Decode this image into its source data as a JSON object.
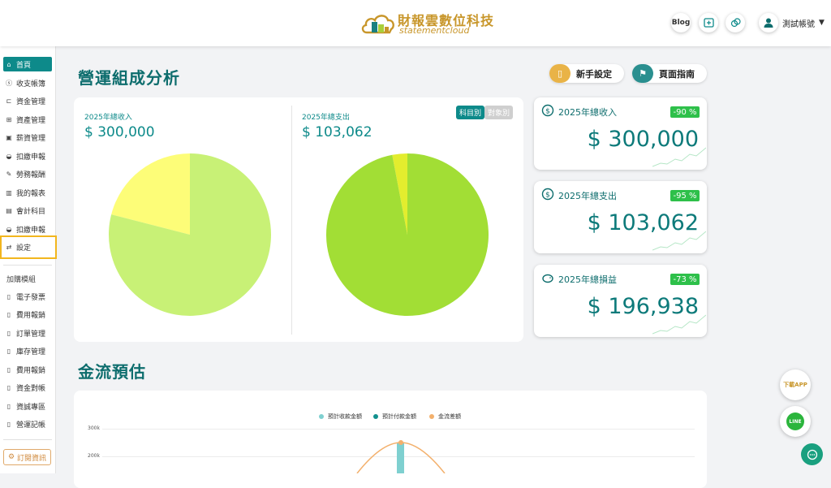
{
  "header": {
    "logo_title": "財報雲數位科技",
    "logo_subtitle": "statementcloud",
    "blog_label": "Blog",
    "user_name": "測試帳號"
  },
  "sidebar": {
    "items": [
      {
        "label": "首頁",
        "icon": "home-icon"
      },
      {
        "label": "收支帳簿",
        "icon": "coin-icon"
      },
      {
        "label": "資金管理",
        "icon": "fund-icon"
      },
      {
        "label": "資產管理",
        "icon": "asset-icon"
      },
      {
        "label": "薪資管理",
        "icon": "salary-icon"
      },
      {
        "label": "扣繳申報",
        "icon": "tax-icon"
      },
      {
        "label": "勞務報酬",
        "icon": "labor-icon"
      },
      {
        "label": "我的報表",
        "icon": "report-icon"
      },
      {
        "label": "會計科目",
        "icon": "ledger-icon"
      },
      {
        "label": "扣繳申報",
        "icon": "tax-icon"
      },
      {
        "label": "設定",
        "icon": "settings-icon"
      }
    ],
    "addon_title": "加購模組",
    "addon_items": [
      "電子發票",
      "費用報銷",
      "訂單管理",
      "庫存管理",
      "費用報銷",
      "資金對帳",
      "資誠專區",
      "營運記帳"
    ],
    "subscribe_label": "訂閱資訊"
  },
  "main": {
    "title": "營運組成分析",
    "new_settings_label": "新手設定",
    "page_guide_label": "頁面指南",
    "income_label": "2025年總收入",
    "income_value": "$ 300,000",
    "expense_label": "2025年總支出",
    "expense_value": "$ 103,062",
    "toggle_subject": "科目別",
    "toggle_object": "對象別",
    "summary_cards": [
      {
        "label": "2025年總收入",
        "badge": "-90 %",
        "value": "$ 300,000",
        "icon": "income-icon"
      },
      {
        "label": "2025年總支出",
        "badge": "-95 %",
        "value": "$ 103,062",
        "icon": "expense-icon"
      },
      {
        "label": "2025年總損益",
        "badge": "-73 %",
        "value": "$ 196,938",
        "icon": "piggy-bank-icon"
      }
    ],
    "cashflow_title": "金流預估",
    "legend": [
      "預計收款金額",
      "預計付款金額",
      "金流差額"
    ],
    "y_ticks": [
      "300k",
      "200k"
    ]
  },
  "fab": {
    "download_app": "下載APP",
    "line": "LINE"
  },
  "colors": {
    "primary": "#0d8a8a",
    "pie_income_main": "#c8f176",
    "pie_income_minor": "#fdfd78",
    "pie_expense_main": "#a2de35",
    "pie_expense_minor": "#e3ed2e",
    "badge": "#2ec04a",
    "accent": "#f2b61e"
  },
  "chart_data": [
    {
      "type": "pie",
      "title": "2025年總收入",
      "slices": [
        {
          "value": 79,
          "color": "#c8f176"
        },
        {
          "value": 21,
          "color": "#fdfd78"
        }
      ]
    },
    {
      "type": "pie",
      "title": "2025年總支出",
      "slices": [
        {
          "value": 97,
          "color": "#a2de35"
        },
        {
          "value": 3,
          "color": "#e3ed2e"
        }
      ]
    }
  ]
}
